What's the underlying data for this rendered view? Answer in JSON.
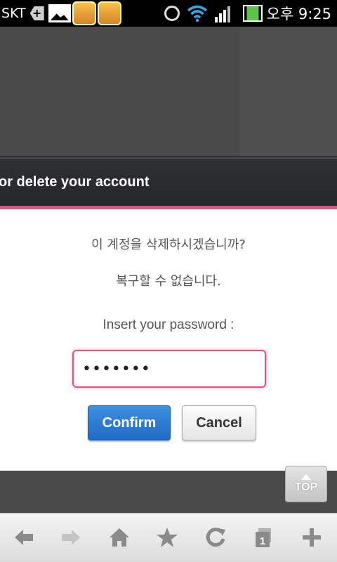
{
  "status_bar": {
    "carrier": "SKT",
    "time": "오후 9:25",
    "icons": [
      "add-notification-icon",
      "image-icon",
      "game-icon",
      "game-icon",
      "alarm-icon",
      "wifi-icon",
      "signal-icon",
      "battery-icon"
    ]
  },
  "dialog": {
    "title": "or delete your account",
    "message_line1": "이 계정을 삭제하시겠습니까?",
    "message_line2": "복구할 수 없습니다.",
    "password_prompt": "Insert your password :",
    "password_value": "•••••••",
    "confirm_label": "Confirm",
    "cancel_label": "Cancel",
    "accent_color": "#ee4e79"
  },
  "page": {
    "top_button_label": "TOP"
  },
  "toolbar": {
    "buttons": [
      "back-icon",
      "forward-icon",
      "home-icon",
      "bookmark-star-icon",
      "refresh-icon",
      "tabs-icon",
      "new-tab-icon"
    ],
    "tabs_count": "1"
  }
}
